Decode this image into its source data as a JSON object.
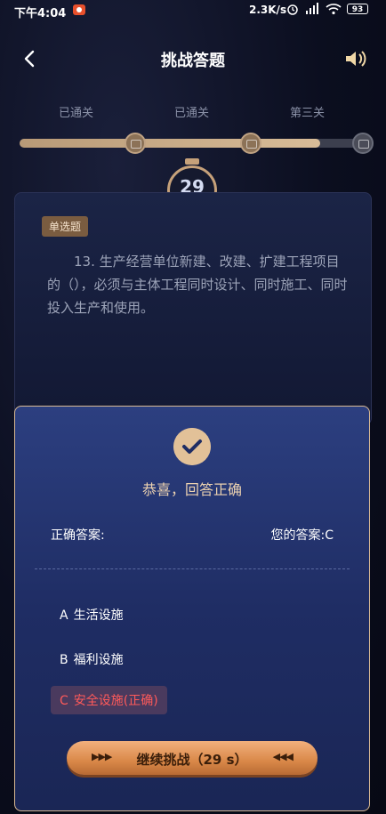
{
  "status_bar": {
    "time": "下午4:04",
    "speed": "2.3K/s",
    "battery": "93",
    "icons": [
      "record-icon",
      "alarm-icon",
      "signal-icon",
      "wifi-icon",
      "battery-icon"
    ]
  },
  "header": {
    "title": "挑战答题",
    "back_icon": "chevron-left-icon",
    "sound_icon": "speaker-icon"
  },
  "levels": {
    "labels": [
      "已通关",
      "已通关",
      "第三关"
    ],
    "progress": 0.87
  },
  "timer": {
    "value": "29"
  },
  "question": {
    "type": "单选题",
    "text": "13. 生产经营单位新建、改建、扩建工程项目的（），必须与主体工程同时设计、同时施工、同时投入生产和使用。"
  },
  "result": {
    "title": "恭喜，回答正确",
    "correct_answer_label": "正确答案:",
    "your_answer_label": "您的答案:",
    "your_answer_value": "C",
    "options": [
      {
        "letter": "A",
        "text": "生活设施"
      },
      {
        "letter": "B",
        "text": "福利设施"
      },
      {
        "letter": "C",
        "text": "安全设施(正确)"
      }
    ],
    "continue_label": "继续挑战（29 s）"
  },
  "colors": {
    "accent": "#e2c198",
    "panel": "#2c3f80",
    "correct_text": "#ff5a5a",
    "button": "#d98848"
  }
}
